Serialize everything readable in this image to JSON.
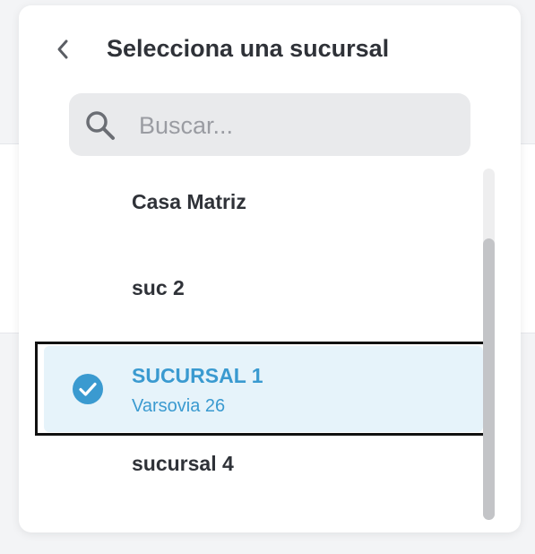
{
  "header": {
    "title": "Selecciona una sucursal",
    "back_icon": "chevron-left-icon"
  },
  "search": {
    "placeholder": "Buscar...",
    "value": "",
    "icon": "search-icon"
  },
  "branches": [
    {
      "name": "Casa Matriz",
      "address": "",
      "selected": false
    },
    {
      "name": "suc 2",
      "address": "",
      "selected": false
    },
    {
      "name": "SUCURSAL 1",
      "address": "Varsovia 26",
      "selected": true
    },
    {
      "name": "sucursal 4",
      "address": "",
      "selected": false
    }
  ],
  "scroll": {
    "position_fraction": 0.2
  },
  "colors": {
    "accent": "#3a9ad0",
    "selected_background": "#e6f3fa",
    "text": "#2f3238",
    "search_background": "#e9eaec"
  }
}
